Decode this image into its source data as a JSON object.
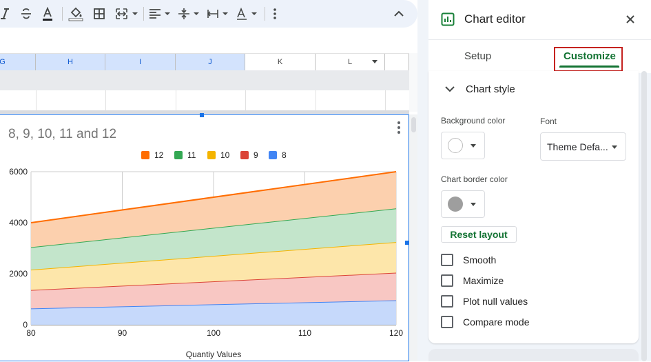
{
  "toolbar": {
    "buttons": [
      "italic-button",
      "strikethrough-button",
      "text-color-button",
      "fill-color-button",
      "borders-button",
      "merge-cells-button",
      "horizontal-align-button",
      "vertical-align-button",
      "text-wrapping-button",
      "text-rotation-button",
      "more-options-button",
      "collapse-button"
    ]
  },
  "columns": [
    {
      "label": "G",
      "selected": true
    },
    {
      "label": "H",
      "selected": true
    },
    {
      "label": "I",
      "selected": true
    },
    {
      "label": "J",
      "selected": true
    },
    {
      "label": "K",
      "selected": false
    },
    {
      "label": "L",
      "selected": false
    }
  ],
  "chart_data": {
    "type": "area",
    "stacked": true,
    "title": "8, 9, 10, 11 and 12",
    "xlabel": "Quantiy Values",
    "ylabel": "",
    "x": [
      80,
      120
    ],
    "xticks": [
      80,
      90,
      100,
      110,
      120
    ],
    "yticks": [
      0,
      2000,
      4000,
      6000
    ],
    "ylim": [
      0,
      6000
    ],
    "xlim": [
      80,
      120
    ],
    "grid": true,
    "legend_position": "top",
    "series": [
      {
        "name": "8",
        "color": "#4285f4",
        "fill": "#c6d9fb",
        "values": [
          640,
          960
        ]
      },
      {
        "name": "9",
        "color": "#db4437",
        "fill": "#f8c7c3",
        "values": [
          720,
          1080
        ]
      },
      {
        "name": "10",
        "color": "#f4b400",
        "fill": "#fde6aa",
        "values": [
          800,
          1200
        ]
      },
      {
        "name": "11",
        "color": "#34a853",
        "fill": "#c3e5cb",
        "values": [
          880,
          1320
        ]
      },
      {
        "name": "12",
        "color": "#ff6d01",
        "fill": "#fcd0ae",
        "values": [
          960,
          1440
        ]
      }
    ],
    "legend_order": [
      "12",
      "11",
      "10",
      "9",
      "8"
    ]
  },
  "panel": {
    "title": "Chart editor",
    "tabs": {
      "setup": "Setup",
      "customize": "Customize"
    },
    "section": "Chart style",
    "background_color_label": "Background color",
    "background_color": "#ffffff",
    "font_label": "Font",
    "font_value": "Theme Defa...",
    "border_color_label": "Chart border color",
    "border_color": "#9e9e9e",
    "reset_label": "Reset layout",
    "checkboxes": [
      {
        "label": "Smooth",
        "checked": false
      },
      {
        "label": "Maximize",
        "checked": false
      },
      {
        "label": "Plot null values",
        "checked": false
      },
      {
        "label": "Compare mode",
        "checked": false
      }
    ]
  }
}
